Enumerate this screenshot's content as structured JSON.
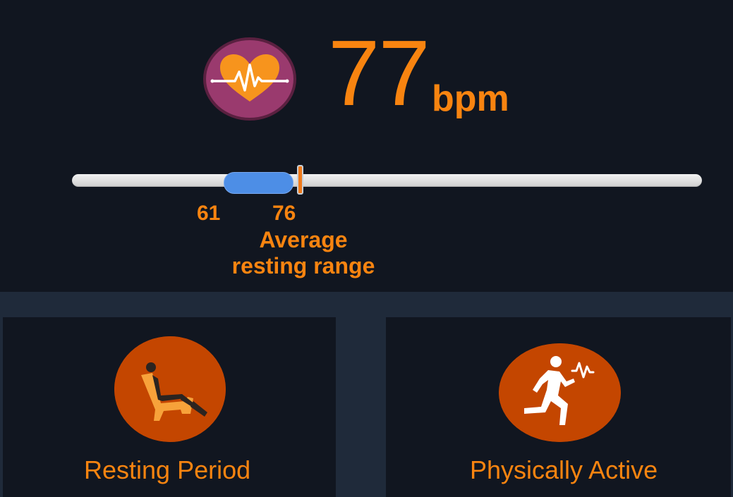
{
  "heart_rate": {
    "value": "77",
    "unit": "bpm",
    "icon": "heart-pulse-icon"
  },
  "resting_range": {
    "scale_min": 30,
    "scale_max": 160,
    "low": 61,
    "high": 76,
    "current": 77,
    "low_label": "61",
    "high_label": "76",
    "caption_line1": "Average",
    "caption_line2": "resting range",
    "fill_color": "#4d8ee6",
    "marker_color": "#f07a1a"
  },
  "modes": [
    {
      "label": "Resting Period",
      "icon": "recliner-chair-icon"
    },
    {
      "label": "Physically Active",
      "icon": "running-person-icon"
    }
  ],
  "colors": {
    "accent": "#f88410",
    "background": "#111620",
    "panel_background": "#1f2a3a",
    "icon_circle": "#c44600",
    "heart_badge": "#9a3a6e"
  }
}
